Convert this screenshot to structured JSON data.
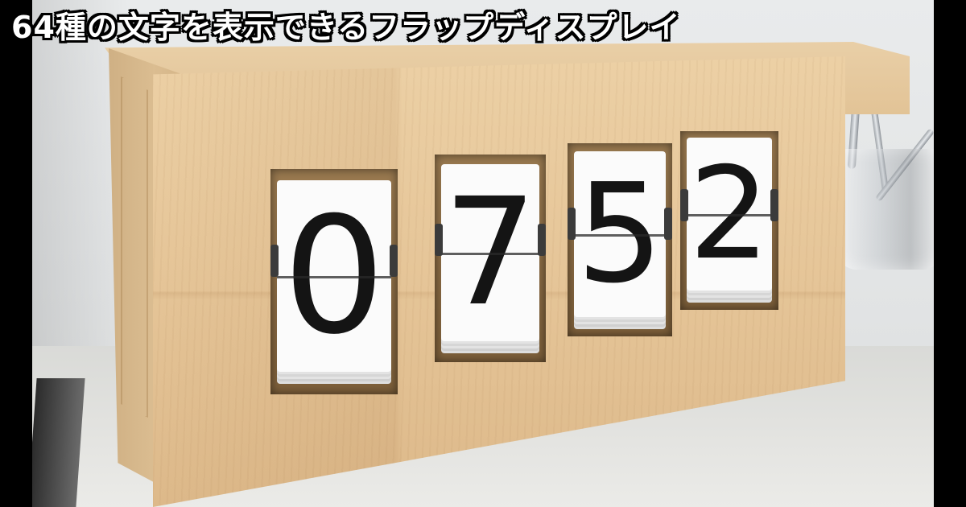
{
  "headline": "64種の文字を表示できるフラップディスプレイ",
  "display": {
    "digits": [
      "0",
      "7",
      "5",
      "2"
    ]
  },
  "colors": {
    "wood": "#e6c699",
    "flap": "#fbfbfb",
    "digit": "#141414",
    "letterbox": "#000000"
  }
}
